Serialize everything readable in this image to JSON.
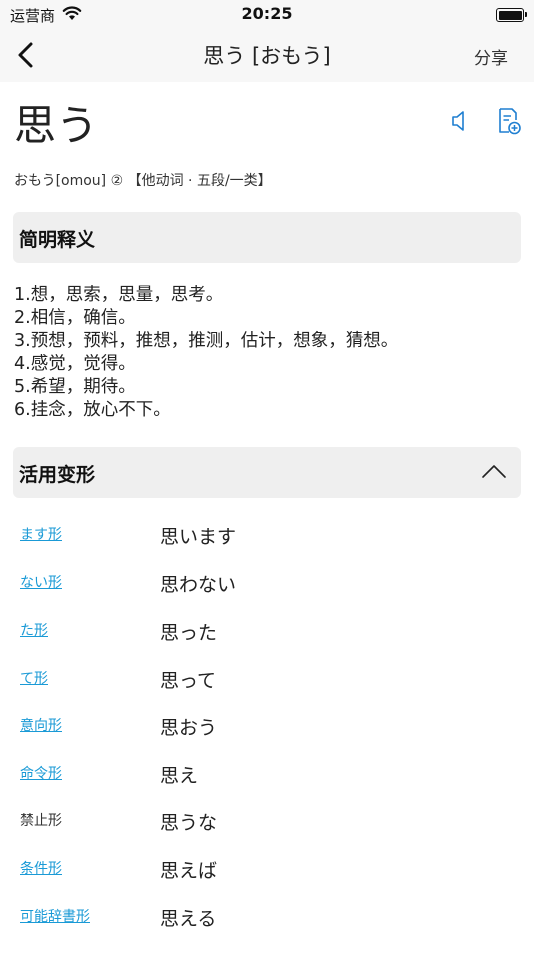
{
  "status": {
    "carrier": "运营商",
    "time": "20:25"
  },
  "nav": {
    "title": "思う [おもう]",
    "share": "分享"
  },
  "entry": {
    "word": "思う",
    "reading": "おもう[omou] ② 【他动词 · 五段/一类】"
  },
  "brief": {
    "heading": "简明释义",
    "definitions": [
      "1.想，思索，思量，思考。",
      "2.相信，确信。",
      "3.预想，预料，推想，推测，估计，想象，猜想。",
      "4.感觉，觉得。",
      "5.希望，期待。",
      "6.挂念，放心不下。"
    ]
  },
  "conjugation": {
    "heading": "活用变形",
    "rows": [
      {
        "label": "ます形",
        "value": "思います",
        "link": true
      },
      {
        "label": "ない形",
        "value": "思わない",
        "link": true
      },
      {
        "label": "た形",
        "value": "思った",
        "link": true
      },
      {
        "label": "て形",
        "value": "思って",
        "link": true
      },
      {
        "label": "意向形",
        "value": "思おう",
        "link": true
      },
      {
        "label": "命令形",
        "value": "思え",
        "link": true
      },
      {
        "label": "禁止形",
        "value": "思うな",
        "link": false
      },
      {
        "label": "条件形",
        "value": "思えば",
        "link": true
      },
      {
        "label": "可能辞書形",
        "value": "思える",
        "link": true
      }
    ]
  },
  "colors": {
    "link": "#1a9ad6",
    "accent": "#1f7fd1",
    "section_bg": "#efefef"
  }
}
